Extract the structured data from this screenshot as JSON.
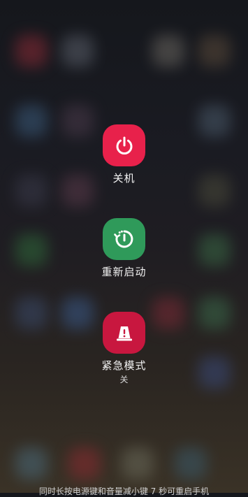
{
  "power_menu": {
    "power_off": {
      "label": "关机",
      "icon": "power-icon",
      "color": "#e8214b"
    },
    "restart": {
      "label": "重新启动",
      "icon": "restart-icon",
      "color": "#2f9a5a"
    },
    "emergency_mode": {
      "label": "紧急模式",
      "status": "关",
      "icon": "emergency-light-icon",
      "color": "#c8173f"
    }
  },
  "hint": {
    "text": "同时长按电源键和音量减小键 7 秒可重启手机"
  }
}
